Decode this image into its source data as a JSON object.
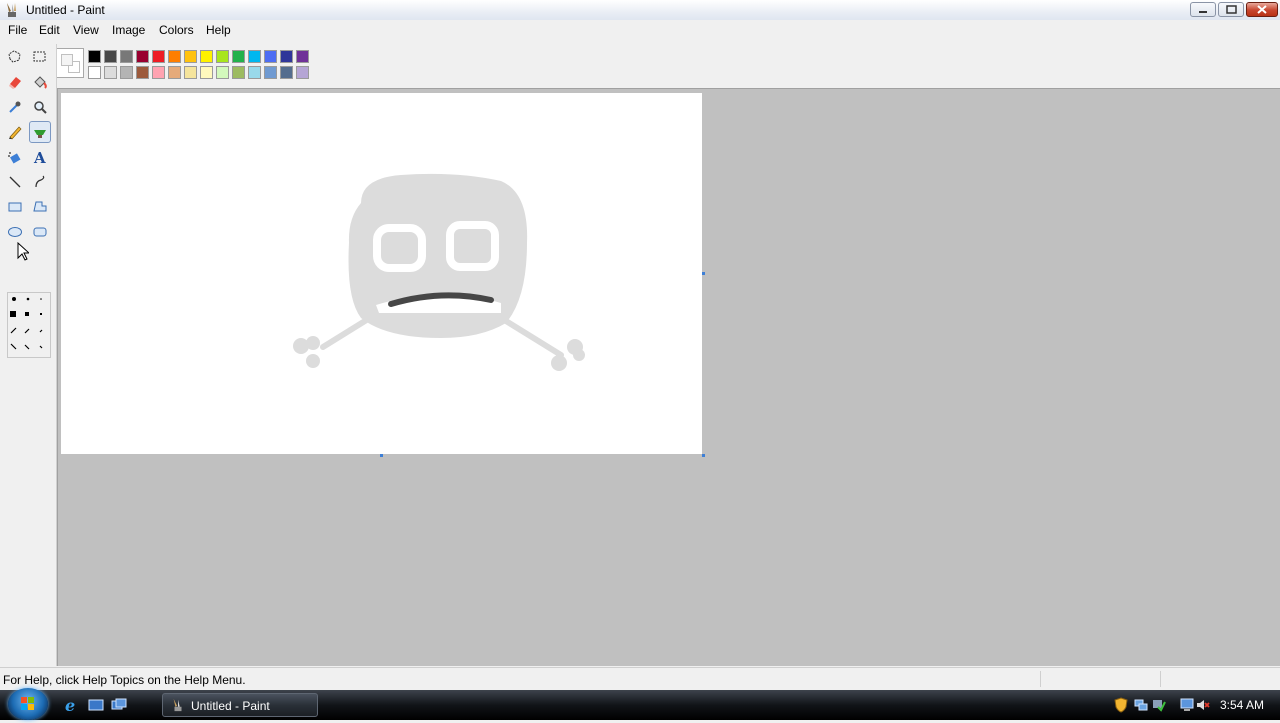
{
  "window": {
    "title": "Untitled - Paint"
  },
  "menu": [
    "File",
    "Edit",
    "View",
    "Image",
    "Colors",
    "Help"
  ],
  "palette": {
    "row1": [
      "#000000",
      "#464646",
      "#787878",
      "#990030",
      "#ed1c24",
      "#ff7e00",
      "#ffc20e",
      "#fff200",
      "#a8e61d",
      "#22b14c",
      "#00b7ef",
      "#4d6df3",
      "#2f3699",
      "#6f3198"
    ],
    "row2": [
      "#ffffff",
      "#dcdcdc",
      "#b4b4b4",
      "#9c5a3c",
      "#ffa3b1",
      "#e5aa7a",
      "#f5e49c",
      "#fff9bd",
      "#d3f9bc",
      "#9dbb61",
      "#99d9ea",
      "#709ad1",
      "#546d8e",
      "#b5a5d5"
    ]
  },
  "tools": [
    "free-form-select",
    "select",
    "eraser",
    "fill-with-color",
    "pick-color",
    "magnifier",
    "pencil",
    "brush",
    "airbrush",
    "text",
    "line",
    "curve",
    "rectangle",
    "polygon",
    "ellipse",
    "rounded-rectangle"
  ],
  "selected_tool": "brush",
  "status": {
    "text": "For Help, click Help Topics on the Help Menu."
  },
  "taskbar": {
    "task_label": "Untitled - Paint",
    "clock": "3:54 AM"
  }
}
